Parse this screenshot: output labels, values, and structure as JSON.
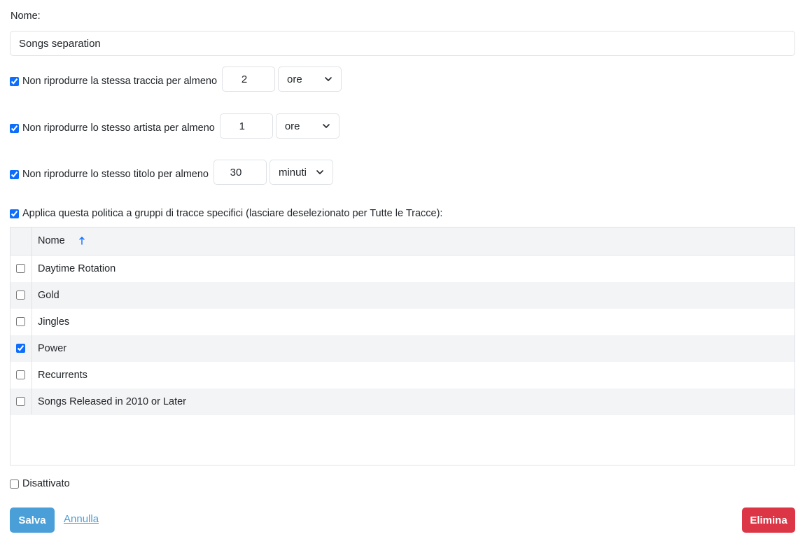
{
  "form": {
    "name_label": "Nome:",
    "name_value": "Songs separation"
  },
  "rules": [
    {
      "checked": true,
      "label": "Non riprodurre la stessa traccia per almeno",
      "value": "2",
      "unit": "ore"
    },
    {
      "checked": true,
      "label": "Non riprodurre lo stesso artista per almeno",
      "value": "1",
      "unit": "ore"
    },
    {
      "checked": true,
      "label": "Non riprodurre lo stesso titolo per almeno",
      "value": "30",
      "unit": "minuti"
    }
  ],
  "apply": {
    "checked": true,
    "label": "Applica questa politica a gruppi di tracce specifici (lasciare deselezionato per Tutte le Tracce):"
  },
  "grid": {
    "header": "Nome",
    "sort": "ascending",
    "rows": [
      {
        "label": "Daytime Rotation",
        "checked": false
      },
      {
        "label": "Gold",
        "checked": false
      },
      {
        "label": "Jingles",
        "checked": false
      },
      {
        "label": "Power",
        "checked": true
      },
      {
        "label": "Recurrents",
        "checked": false
      },
      {
        "label": "Songs Released in 2010 or Later",
        "checked": false
      }
    ]
  },
  "disabled": {
    "checked": false,
    "label": "Disattivato"
  },
  "actions": {
    "save": "Salva",
    "cancel": "Annulla",
    "delete": "Elimina"
  },
  "colors": {
    "primary": "#4a9fd8",
    "danger": "#dc3545",
    "checkbox": "#0d6efd",
    "row_alt": "#f3f4f6"
  },
  "icons": {
    "select": "chevron-down-icon",
    "sort": "arrow-up-icon"
  }
}
